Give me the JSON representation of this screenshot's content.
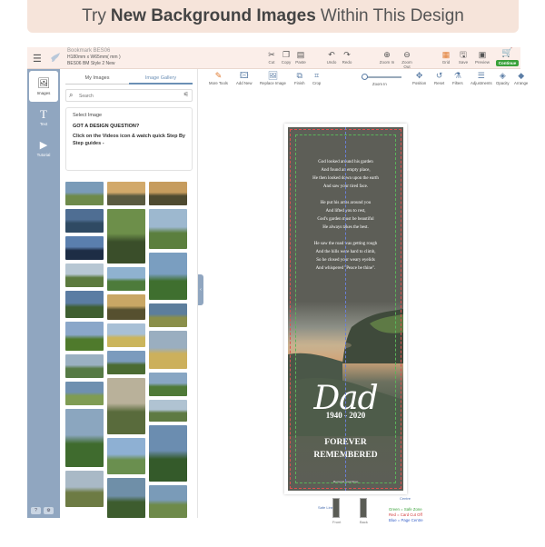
{
  "banner": {
    "prefix": "Try",
    "emphasis": "New Background Images",
    "suffix": "Within This Design"
  },
  "project": {
    "title": "Bookmark BES06",
    "size": "H180mm x W65mm( mm )",
    "style": "BES06 BM Style 2 New"
  },
  "topbar": {
    "cut": "Cut",
    "copy": "Copy",
    "paste": "Paste",
    "undo": "Undo",
    "redo": "Redo",
    "zoom_in": "Zoom In",
    "zoom_out": "Zoom Out",
    "grid": "Grid",
    "save": "Save",
    "preview": "Preview",
    "continue": "Continue"
  },
  "rail": {
    "images": "Images",
    "text": "Text",
    "tutorial": "Tutorial",
    "foot": [
      "?",
      "⚙"
    ]
  },
  "panel": {
    "tabs": [
      "My Images",
      "Image Gallery"
    ],
    "active_tab": "Image Gallery",
    "search_placeholder": "Search",
    "help_select": "Select Image",
    "help_question": "GOT A DESIGN QUESTION?",
    "help_text": "Click on the Videos icon & watch quick Step By Step guides -"
  },
  "toolbar2": {
    "more_tools": "More Tools",
    "add_new": "Add New",
    "replace_image": "Replace Image",
    "finish": "Finish",
    "crop": "Crop",
    "zoom_in": "Zoom In",
    "position": "Position",
    "reset": "Reset",
    "filters": "Filters",
    "adjustments": "Adjustments",
    "opacity": "Opacity",
    "arrange": "Arrange"
  },
  "zoom_level": 0.05,
  "bookmark": {
    "poem": [
      [
        "God looked around his garden",
        "And found an empty place,",
        "He then looked down upon the earth",
        "And saw your tired face."
      ],
      [
        "He put his arms around you",
        "And lifted you to rest,",
        "God's garden must be beautiful",
        "He always takes the best."
      ],
      [
        "He saw the road was getting rough",
        "And the hills were hard to climb,",
        "So he closed your weary eyelids",
        "And whispered \"Peace be thine\"."
      ]
    ],
    "name": "Dad",
    "dates": "1940 - 2020",
    "closing": [
      "FOREVER",
      "REMEMBERED"
    ],
    "credit": "Memorial Card Shop"
  },
  "canvas": {
    "safe_line": "Safe Line",
    "centre": "Centre",
    "page_front": "Front",
    "page_back": "Back"
  },
  "legend": {
    "green": "Green = Safe Zone",
    "red": "Red = Card Cut Off",
    "blue": "Blue = Page Centre"
  },
  "colors": {
    "rail": "#90a6c0",
    "accent": "#6b8fb5",
    "continue": "#3aa13a",
    "banner": "#f6e4da"
  }
}
